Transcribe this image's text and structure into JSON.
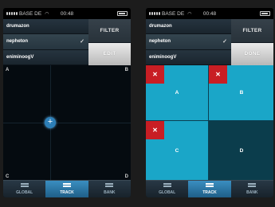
{
  "status": {
    "carrier": "BASE DE",
    "time": "00:48"
  },
  "presets": [
    "drumazon",
    "nepheton",
    "eniminoogV"
  ],
  "buttons": {
    "filter": "FILTER",
    "edit": "EDIT",
    "done": "DONE"
  },
  "xy_pad": {
    "corners": [
      "A",
      "B",
      "C",
      "D"
    ]
  },
  "pads": [
    {
      "label": "A",
      "has_delete": true
    },
    {
      "label": "B",
      "has_delete": true
    },
    {
      "label": "C",
      "has_delete": true
    },
    {
      "label": "D",
      "has_delete": false
    }
  ],
  "delete_symbol": "✕",
  "tabs": [
    "GLOBAL",
    "TRACK",
    "BANK"
  ],
  "active_tab": "TRACK",
  "colors": {
    "accent": "#1aa6c8",
    "delete": "#c81e24",
    "tab_active": "#2d7fb8"
  }
}
